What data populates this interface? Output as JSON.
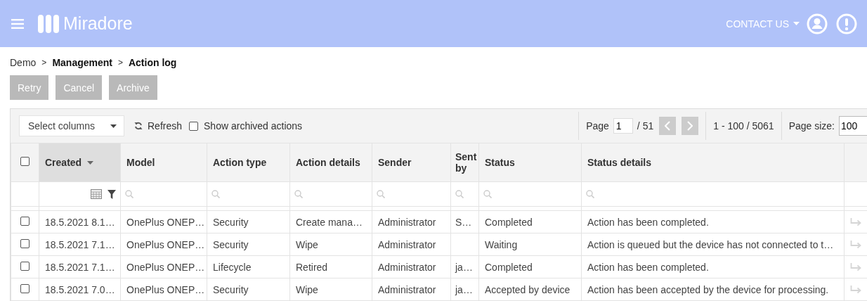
{
  "header": {
    "logo_text": "Miradore",
    "contact": "CONTACT US"
  },
  "breadcrumb": [
    {
      "kind": "link",
      "text": "Demo"
    },
    {
      "kind": "separator",
      "text": ">"
    },
    {
      "kind": "link",
      "text": "Management"
    },
    {
      "kind": "separator",
      "text": ">"
    },
    {
      "kind": "current",
      "text": "Action log"
    }
  ],
  "actions": [
    {
      "label": "Retry",
      "disabled": true
    },
    {
      "label": "Cancel",
      "disabled": true
    },
    {
      "label": "Archive",
      "disabled": true
    }
  ],
  "toolbar": {
    "select_columns": "Select columns",
    "refresh": "Refresh",
    "show_archived": {
      "label": "Show archived actions",
      "checked": false
    },
    "page_label": "Page",
    "page": "1",
    "page_total": "/ 51",
    "prev_disabled": true,
    "next_disabled": true,
    "range": "1 - 100 / 5061",
    "page_size_label": "Page size:",
    "page_size": "100"
  },
  "table": {
    "columns": [
      {
        "label": "Created",
        "sorted": true,
        "kind": "date"
      },
      {
        "label": "Model",
        "sorted": false,
        "kind": "text"
      },
      {
        "label": "Action type",
        "sorted": false,
        "kind": "text"
      },
      {
        "label": "Action details",
        "sorted": false,
        "kind": "text"
      },
      {
        "label": "Sender",
        "sorted": false,
        "kind": "text"
      },
      {
        "label": "Sent by",
        "sorted": false,
        "kind": "text"
      },
      {
        "label": "Status",
        "sorted": false,
        "kind": "text"
      },
      {
        "label": "Status details",
        "sorted": false,
        "kind": "text"
      }
    ],
    "all_checked": false,
    "rows": [
      {
        "checked": false,
        "cells": [
          "18.5.2021 8.1…",
          "OnePlus ONEP…",
          "Security",
          "Create mana…",
          "Administrator",
          "S…",
          "Completed",
          "Action has been completed."
        ]
      },
      {
        "checked": false,
        "cells": [
          "18.5.2021 7.1…",
          "OnePlus ONEP…",
          "Security",
          "Wipe",
          "Administrator",
          null,
          "Waiting",
          "Action is queued but the device has not connected to t…"
        ]
      },
      {
        "checked": false,
        "cells": [
          "18.5.2021 7.1…",
          "OnePlus ONEP…",
          "Lifecycle",
          "Retired",
          "Administrator",
          "ja…",
          "Completed",
          "Action has been completed."
        ]
      },
      {
        "checked": false,
        "cells": [
          "18.5.2021 7.0…",
          "OnePlus ONEP…",
          "Security",
          "Wipe",
          "Administrator",
          "ja…",
          "Accepted by device",
          "Action has been accepted by the device for processing."
        ]
      }
    ]
  }
}
